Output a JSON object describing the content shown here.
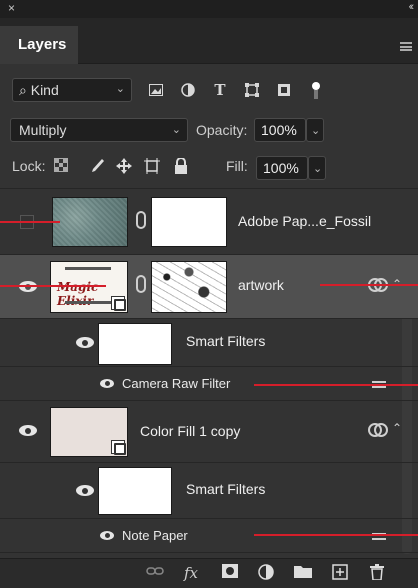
{
  "window": {
    "close_glyph": "×",
    "collapse_glyph": "‹‹"
  },
  "tabs": [
    {
      "label": "Layers"
    }
  ],
  "filter": {
    "kind_label": "Kind",
    "icons": [
      "pixel-filter-icon",
      "adjustment-filter-icon",
      "type-filter-icon",
      "shape-filter-icon",
      "smart-object-filter-icon",
      "filter-toggle-icon"
    ]
  },
  "blend": {
    "mode": "Multiply",
    "opacity_label": "Opacity:",
    "opacity_value": "100%"
  },
  "lock": {
    "label": "Lock:",
    "fill_label": "Fill:",
    "fill_value": "100%"
  },
  "layers": [
    {
      "name": "Adobe Pap...e_Fossil",
      "visible": false,
      "selected": false
    },
    {
      "name": "artwork",
      "visible": true,
      "selected": true,
      "thumb_text": "Magic Elixir"
    },
    {
      "name": "Smart Filters",
      "kind": "smart-filters"
    },
    {
      "name": "Camera Raw Filter",
      "kind": "filter"
    },
    {
      "name": "Color Fill 1 copy",
      "visible": true,
      "selected": false
    },
    {
      "name": "Smart Filters",
      "kind": "smart-filters"
    },
    {
      "name": "Note Paper",
      "kind": "filter"
    }
  ],
  "bottom_bar": {
    "icons": [
      "link-layers-icon",
      "fx-icon",
      "mask-icon",
      "adjustment-icon",
      "group-folder-icon",
      "new-layer-icon",
      "delete-icon"
    ],
    "fx_label": "fx"
  },
  "colors": {
    "panel_bg": "#333333",
    "selected_row": "#505050",
    "annotation_red": "#d51e2a"
  }
}
